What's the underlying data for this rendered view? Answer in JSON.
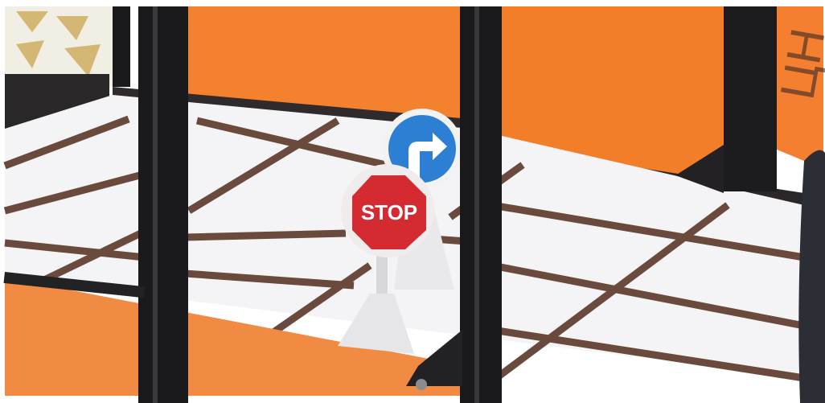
{
  "scene": {
    "description_free": true,
    "stop_sign": {
      "text": "STOP",
      "color": "#d42a32",
      "text_color": "#ffffff"
    },
    "turn_sign": {
      "icon": "arrow-up-turn-right-icon",
      "color": "#2d7fd3"
    },
    "wall_text": {
      "text": "ЦН"
    },
    "colors": {
      "orange_wall": "#f3812d",
      "orange_floor": "#f18a43",
      "floor": "#f4f4f6",
      "road_line": "#6b4a3e",
      "frame": "#1a1a1c"
    }
  }
}
